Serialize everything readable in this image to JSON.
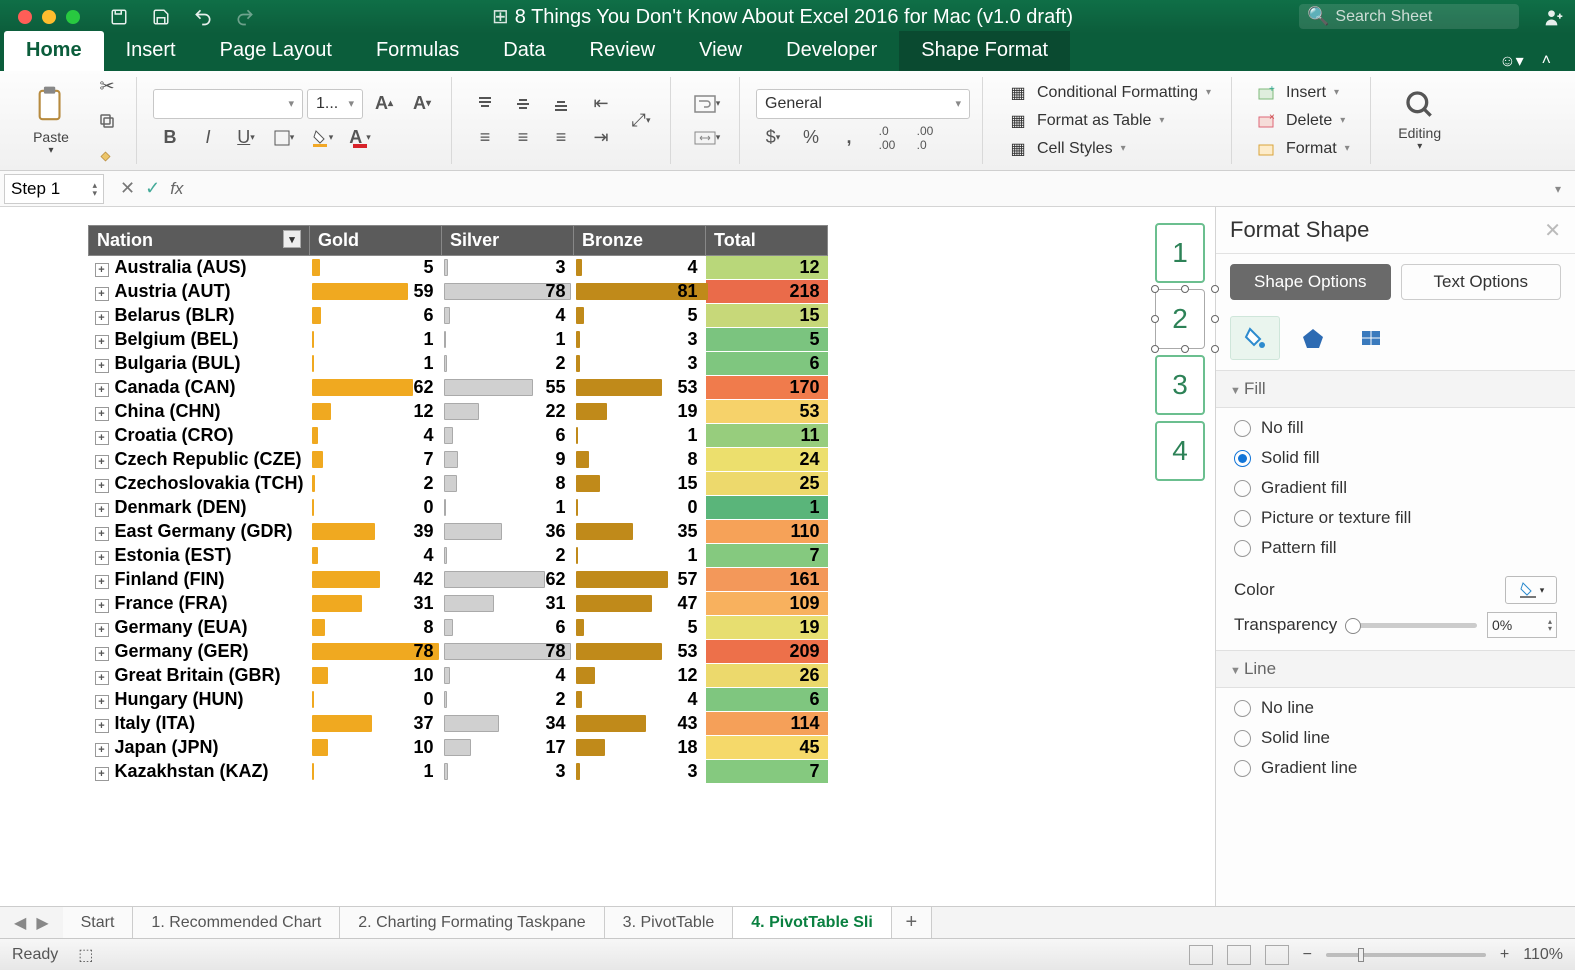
{
  "window": {
    "title": "8 Things You Don't Know About Excel 2016 for Mac (v1.0 draft)",
    "search_placeholder": "Search Sheet"
  },
  "tabs": {
    "items": [
      "Home",
      "Insert",
      "Page Layout",
      "Formulas",
      "Data",
      "Review",
      "View",
      "Developer",
      "Shape Format"
    ],
    "active": "Home",
    "special": "Shape Format"
  },
  "ribbon": {
    "paste": "Paste",
    "font_size": "1...",
    "number_format": "General",
    "cond_fmt": "Conditional Formatting",
    "fmt_table": "Format as Table",
    "cell_styles": "Cell Styles",
    "insert": "Insert",
    "delete": "Delete",
    "format": "Format",
    "editing": "Editing"
  },
  "name_box": "Step 1",
  "table": {
    "headers": [
      "Nation",
      "Gold",
      "Silver",
      "Bronze",
      "Total"
    ],
    "rows": [
      {
        "nation": "Australia (AUS)",
        "gold": 5,
        "silver": 3,
        "bronze": 4,
        "total": 12,
        "tc": "#b9d77a"
      },
      {
        "nation": "Austria (AUT)",
        "gold": 59,
        "silver": 78,
        "bronze": 81,
        "total": 218,
        "tc": "#ea6b4a"
      },
      {
        "nation": "Belarus (BLR)",
        "gold": 6,
        "silver": 4,
        "bronze": 5,
        "total": 15,
        "tc": "#c7d879"
      },
      {
        "nation": "Belgium (BEL)",
        "gold": 1,
        "silver": 1,
        "bronze": 3,
        "total": 5,
        "tc": "#7bc47f"
      },
      {
        "nation": "Bulgaria (BUL)",
        "gold": 1,
        "silver": 2,
        "bronze": 3,
        "total": 6,
        "tc": "#7fc67f"
      },
      {
        "nation": "Canada (CAN)",
        "gold": 62,
        "silver": 55,
        "bronze": 53,
        "total": 170,
        "tc": "#f07b4c"
      },
      {
        "nation": "China (CHN)",
        "gold": 12,
        "silver": 22,
        "bronze": 19,
        "total": 53,
        "tc": "#f6d26a"
      },
      {
        "nation": "Croatia (CRO)",
        "gold": 4,
        "silver": 6,
        "bronze": 1,
        "total": 11,
        "tc": "#97cd7d"
      },
      {
        "nation": "Czech Republic (CZE)",
        "gold": 7,
        "silver": 9,
        "bronze": 8,
        "total": 24,
        "tc": "#ecdf6d"
      },
      {
        "nation": "Czechoslovakia (TCH)",
        "gold": 2,
        "silver": 8,
        "bronze": 15,
        "total": 25,
        "tc": "#edd96c"
      },
      {
        "nation": "Denmark (DEN)",
        "gold": 0,
        "silver": 1,
        "bronze": 0,
        "total": 1,
        "tc": "#5ab57a"
      },
      {
        "nation": "East Germany (GDR)",
        "gold": 39,
        "silver": 36,
        "bronze": 35,
        "total": 110,
        "tc": "#f6a258"
      },
      {
        "nation": "Estonia (EST)",
        "gold": 4,
        "silver": 2,
        "bronze": 1,
        "total": 7,
        "tc": "#85c97f"
      },
      {
        "nation": "Finland (FIN)",
        "gold": 42,
        "silver": 62,
        "bronze": 57,
        "total": 161,
        "tc": "#f3985a"
      },
      {
        "nation": "France (FRA)",
        "gold": 31,
        "silver": 31,
        "bronze": 47,
        "total": 109,
        "tc": "#f8b15e"
      },
      {
        "nation": "Germany (EUA)",
        "gold": 8,
        "silver": 6,
        "bronze": 5,
        "total": 19,
        "tc": "#e7de70"
      },
      {
        "nation": "Germany (GER)",
        "gold": 78,
        "silver": 78,
        "bronze": 53,
        "total": 209,
        "tc": "#ed704a"
      },
      {
        "nation": "Great Britain (GBR)",
        "gold": 10,
        "silver": 4,
        "bronze": 12,
        "total": 26,
        "tc": "#ecd96c"
      },
      {
        "nation": "Hungary (HUN)",
        "gold": 0,
        "silver": 2,
        "bronze": 4,
        "total": 6,
        "tc": "#7fc67f"
      },
      {
        "nation": "Italy (ITA)",
        "gold": 37,
        "silver": 34,
        "bronze": 43,
        "total": 114,
        "tc": "#f5a059"
      },
      {
        "nation": "Japan (JPN)",
        "gold": 10,
        "silver": 17,
        "bronze": 18,
        "total": 45,
        "tc": "#f5d96a"
      },
      {
        "nation": "Kazakhstan (KAZ)",
        "gold": 1,
        "silver": 3,
        "bronze": 3,
        "total": 7,
        "tc": "#85c97f"
      }
    ],
    "max": 81
  },
  "slicers": [
    "1",
    "2",
    "3",
    "4"
  ],
  "format_pane": {
    "title": "Format Shape",
    "shape_options": "Shape Options",
    "text_options": "Text Options",
    "fill": "Fill",
    "fill_opts": [
      "No fill",
      "Solid fill",
      "Gradient fill",
      "Picture or texture fill",
      "Pattern fill"
    ],
    "fill_selected": "Solid fill",
    "color": "Color",
    "transparency": "Transparency",
    "trans_val": "0%",
    "line": "Line",
    "line_opts": [
      "No line",
      "Solid line",
      "Gradient line"
    ]
  },
  "sheet_tabs": {
    "items": [
      "Start",
      "1. Recommended Chart",
      "2. Charting Formating Taskpane",
      "3. PivotTable",
      "4. PivotTable Sli"
    ],
    "active": "4. PivotTable Sli"
  },
  "status": {
    "ready": "Ready",
    "zoom": "110%"
  }
}
